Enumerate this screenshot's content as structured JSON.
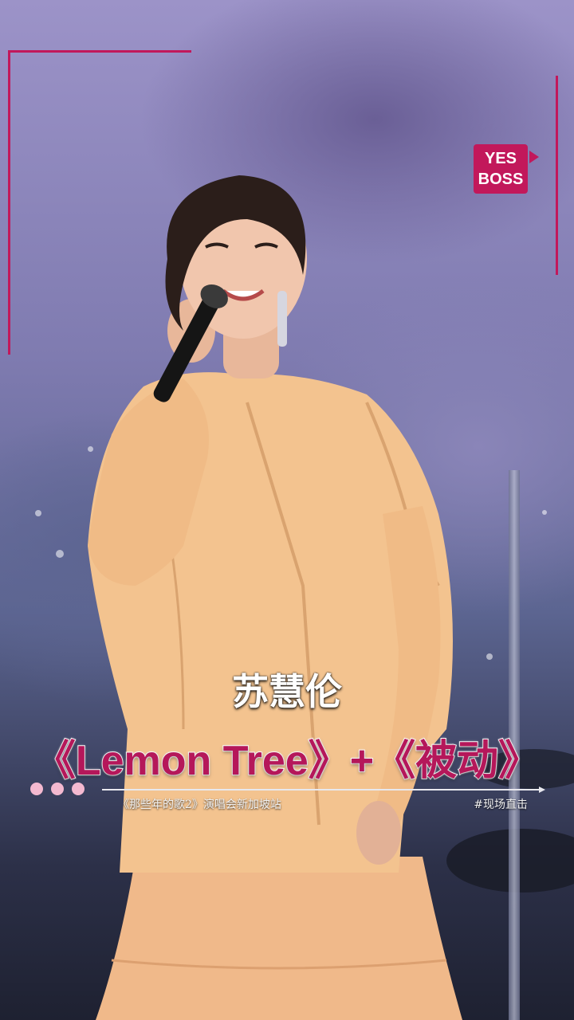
{
  "logo": {
    "line1": "YES",
    "line2": "BOSS"
  },
  "overlay": {
    "artist": "苏慧伦",
    "songs": "《Lemon Tree》+《被动》",
    "subtitle": "《那些年的歌2》演唱会新加坡站",
    "hashtag": "#现场直击"
  },
  "colors": {
    "accent": "#c2185b",
    "song_title": "#b5175a",
    "dots": "#f4b9d0"
  }
}
